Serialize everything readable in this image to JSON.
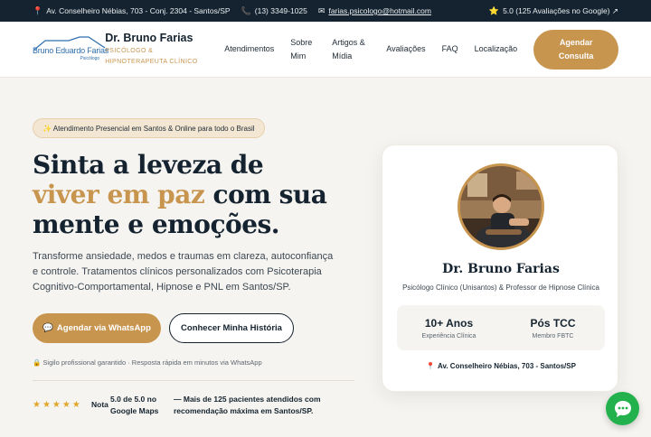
{
  "topbar": {
    "address": "Av. Conselheiro Nébias, 703 - Conj. 2304 - Santos/SP",
    "phone": "(13) 3349-1025",
    "email": "farias.psicologo@hotmail.com",
    "rating": "5.0 (125 Avaliações no Google) ↗",
    "icons": {
      "address": "pin-icon",
      "phone": "phone-icon",
      "email": "mail-icon",
      "rating": "star-icon"
    }
  },
  "header": {
    "logo_name": "Bruno Eduardo Farias",
    "logo_sub": "Psicólogo",
    "brand_name": "Dr. Bruno Farias",
    "brand_tagline": "PSICÓLOGO & HIPNOTERAPEUTA CLÍNICO",
    "nav": [
      "Atendimentos",
      "Sobre Mim",
      "Artigos & Mídia",
      "Avaliações",
      "FAQ",
      "Localização"
    ],
    "cta": "Agendar Consulta"
  },
  "hero": {
    "badge": "✨ Atendimento Presencial em Santos & Online para todo o Brasil",
    "headline_part1": "Sinta a leveza de ",
    "headline_highlight": "viver em paz",
    "headline_part2": " com sua mente e emoções.",
    "lead": "Transforme ansiedade, medos e traumas em clareza, autoconfiança e controle. Tratamentos clínicos personalizados com Psicoterapia Cognitivo-Comportamental, Hipnose e PNL em Santos/SP.",
    "whatsapp_button": "Agendar via WhatsApp",
    "story_button": "Conhecer Minha História",
    "privacy": "🔒 Sigilo profissional garantido · Resposta rápida em minutos via WhatsApp",
    "stars": "★★★★★",
    "rating_prefix": "Nota",
    "rating_score": "5.0 de 5.0 no Google Maps",
    "rating_note": "— Mais de 125 pacientes atendidos com recomendação máxima em Santos/SP."
  },
  "card": {
    "name": "Dr. Bruno Farias",
    "role": "Psicólogo Clínico (Unisantos) & Professor de Hipnose Clínica",
    "stats": [
      {
        "value": "10+ Anos",
        "label": "Experiência Clínica"
      },
      {
        "value": "Pós TCC",
        "label": "Membro FBTC"
      }
    ],
    "address": "Av. Conselheiro Nébias, 703 - Santos/SP"
  },
  "fab": {
    "icon": "chat-icon"
  },
  "colors": {
    "accent": "#c8954f",
    "dark": "#14232f",
    "background": "#f6f4f0",
    "whatsapp": "#22b14c"
  }
}
